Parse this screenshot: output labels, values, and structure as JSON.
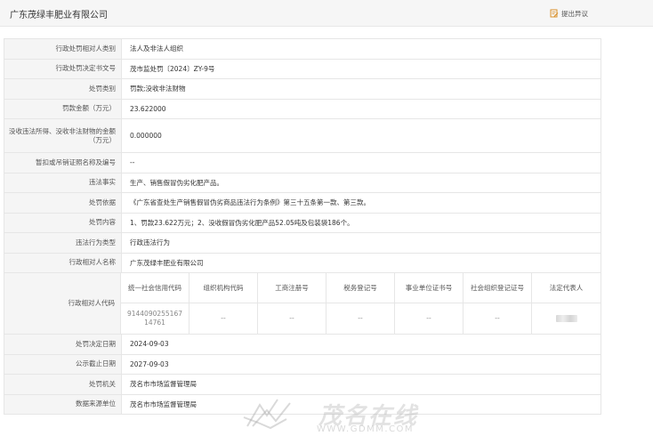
{
  "header": {
    "company_name": "广东茂绿丰肥业有限公司",
    "objection_label": "提出异议"
  },
  "rows": [
    {
      "label": "行政处罚相对人类别",
      "value": "法人及非法人组织"
    },
    {
      "label": "行政处罚决定书文号",
      "value": "茂市监处罚〔2024〕ZY-9号"
    },
    {
      "label": "处罚类别",
      "value": "罚款;没收非法财物"
    },
    {
      "label": "罚款金额（万元）",
      "value": "23.622000"
    },
    {
      "label": "没收违法所得、没收非法财物的金额（万元）",
      "value": "0.000000"
    },
    {
      "label": "暂扣或吊销证照名称及编号",
      "value": "--"
    },
    {
      "label": "违法事实",
      "value": "生产、销售假冒伪劣化肥产品。"
    },
    {
      "label": "处罚依据",
      "value": "《广东省查处生产销售假冒伪劣商品违法行为条例》第三十五条第一款、第三款。"
    },
    {
      "label": "处罚内容",
      "value": "1、罚款23.622万元；2、没收假冒伪劣化肥产品52.05吨及包装袋186个。"
    },
    {
      "label": "违法行为类型",
      "value": "行政违法行为"
    },
    {
      "label": "行政相对人名称",
      "value": "广东茂绿丰肥业有限公司"
    }
  ],
  "codes": {
    "label": "行政相对人代码",
    "headers": [
      "统一社会信用代码",
      "组织机构代码",
      "工商注册号",
      "税务登记号",
      "事业单位证书号",
      "社会组织登记证号",
      "法定代表人"
    ],
    "values": [
      "914409025516714761",
      "--",
      "--",
      "--",
      "--",
      "--"
    ]
  },
  "tail_rows": [
    {
      "label": "处罚决定日期",
      "value": "2024-09-03"
    },
    {
      "label": "公示截止日期",
      "value": "2027-09-03"
    },
    {
      "label": "处罚机关",
      "value": "茂名市市场监督管理局"
    },
    {
      "label": "数据来源单位",
      "value": "茂名市市场监督管理局"
    }
  ],
  "watermark": {
    "brand": "茂名在线",
    "url": "WWW.GDMM.COM"
  },
  "icons": {
    "objection": "edit-document-icon",
    "watermark_logo": "gdmm-logo-icon"
  }
}
